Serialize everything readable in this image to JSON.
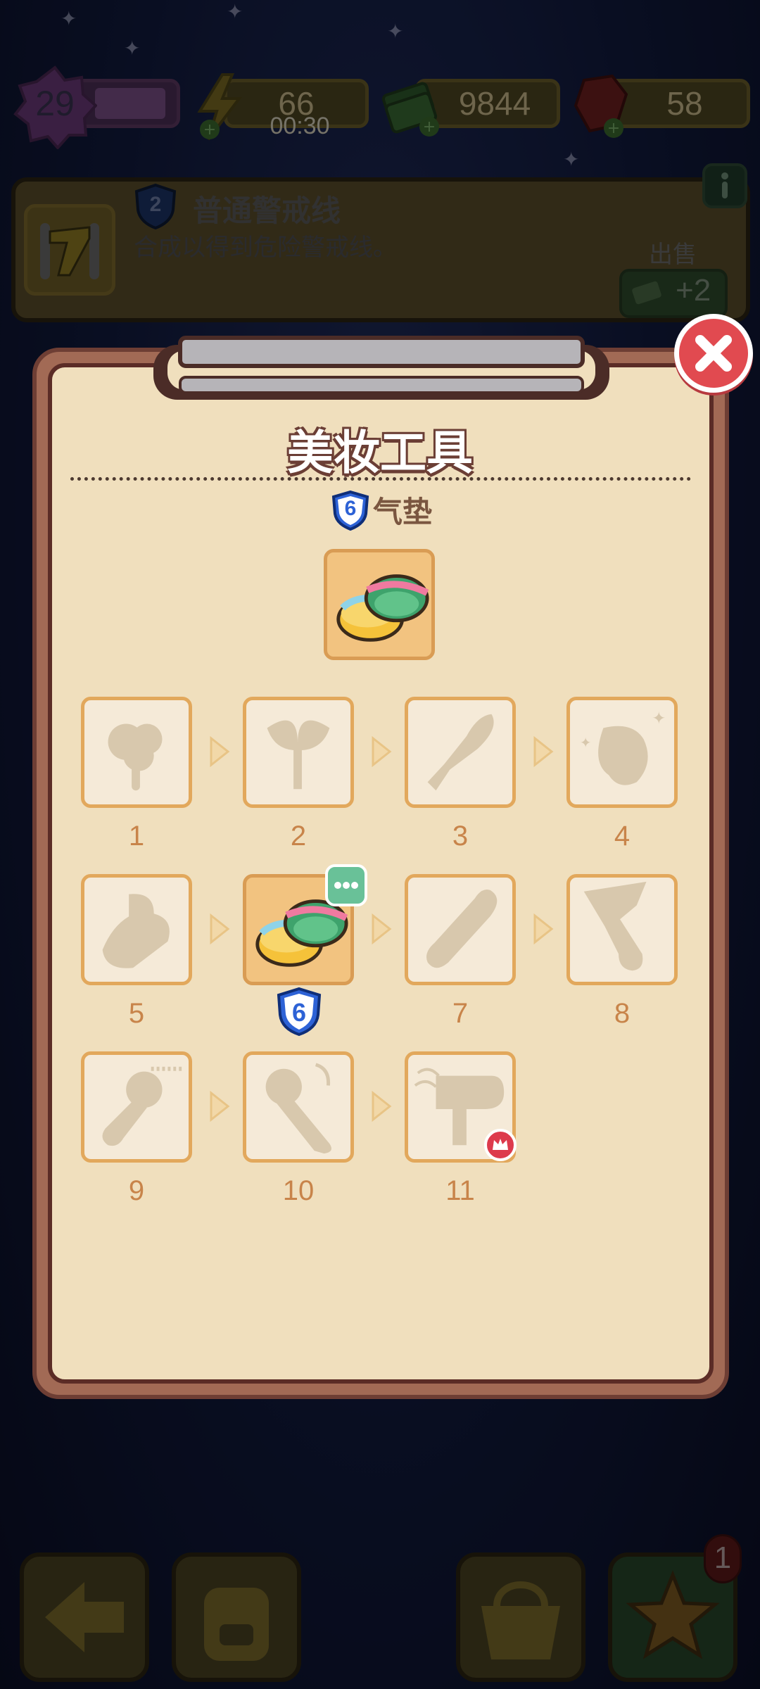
{
  "top_bar": {
    "level": "29",
    "energy": "66",
    "energy_timer": "00:30",
    "cash": "9844",
    "gems": "58"
  },
  "info_card": {
    "tier": "2",
    "title": "普通警戒线",
    "description": "合成以得到危险警戒线。",
    "sell_label": "出售",
    "sell_value": "+2"
  },
  "modal": {
    "title": "美妆工具",
    "current_item": {
      "tier": "6",
      "name": "气垫"
    },
    "chain": [
      {
        "label": "1",
        "state": "locked"
      },
      {
        "label": "2",
        "state": "locked"
      },
      {
        "label": "3",
        "state": "locked"
      },
      {
        "label": "4",
        "state": "locked"
      },
      {
        "label": "5",
        "state": "locked"
      },
      {
        "label": "6",
        "state": "owned"
      },
      {
        "label": "7",
        "state": "locked"
      },
      {
        "label": "8",
        "state": "locked"
      },
      {
        "label": "9",
        "state": "locked"
      },
      {
        "label": "10",
        "state": "locked"
      },
      {
        "label": "11",
        "state": "locked-premium"
      }
    ]
  },
  "bottom_bar": {
    "notification_count": "1"
  },
  "colors": {
    "accent_gold": "#e2a85c",
    "modal_paper": "#f0dfbd",
    "close_red": "#e14a50",
    "shield_blue": "#2d62d6"
  }
}
